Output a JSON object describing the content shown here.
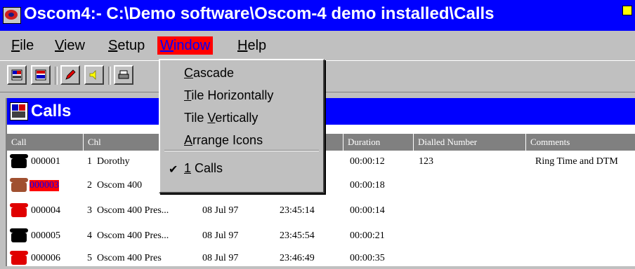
{
  "window": {
    "title": "Oscom4:- C:\\Demo software\\Oscom-4 demo installed\\Calls"
  },
  "menubar": {
    "file": {
      "u": "F",
      "rest": "ile"
    },
    "view": {
      "u": "V",
      "rest": "iew"
    },
    "setup": {
      "u": "S",
      "rest": "etup"
    },
    "window": {
      "u": "W",
      "rest": "indow"
    },
    "help": {
      "u": "H",
      "rest": "elp"
    }
  },
  "window_menu": {
    "cascade": {
      "u": "C",
      "rest": "ascade"
    },
    "tile_h": {
      "u": "T",
      "rest": "ile Horizontally"
    },
    "tile_v": {
      "pre": "Tile ",
      "u": "V",
      "rest": "ertically"
    },
    "arrange": {
      "u": "A",
      "rest": "rrange Icons"
    },
    "calls": {
      "u": "1",
      "rest": " Calls"
    },
    "check": "✔"
  },
  "child": {
    "title": "Calls"
  },
  "table": {
    "headers": {
      "call": "Call",
      "chl": "Chl",
      "duration": "Duration",
      "dialled": "Dialled Number",
      "comments": "Comments"
    },
    "rows": [
      {
        "call": "000001",
        "chl": "1",
        "name": "Dorothy",
        "date": "",
        "time": "",
        "duration": "00:00:12",
        "dialled": "123",
        "comments": "Ring Time and DTM"
      },
      {
        "call": "000003",
        "chl": "2",
        "name": "Oscom 400",
        "date": "",
        "time": "",
        "duration": "00:00:18",
        "dialled": "",
        "comments": ""
      },
      {
        "call": "000004",
        "chl": "3",
        "name": "Oscom 400 Pres...",
        "date": "08 Jul 97",
        "time": "23:45:14",
        "duration": "00:00:14",
        "dialled": "",
        "comments": ""
      },
      {
        "call": "000005",
        "chl": "4",
        "name": "Oscom 400 Pres...",
        "date": "08 Jul 97",
        "time": "23:45:54",
        "duration": "00:00:21",
        "dialled": "",
        "comments": ""
      },
      {
        "call": "000006",
        "chl": "5",
        "name": "Oscom 400 Pres",
        "date": "08 Jul 97",
        "time": "23:46:49",
        "duration": "00:00:35",
        "dialled": "",
        "comments": ""
      }
    ]
  },
  "colors": {
    "titlebar": "#0000ff",
    "highlight": "#ff0000",
    "face": "#c0c0c0"
  },
  "icons": [
    "oscom-app-icon",
    "calls-window-icon",
    "telephone-icon"
  ]
}
